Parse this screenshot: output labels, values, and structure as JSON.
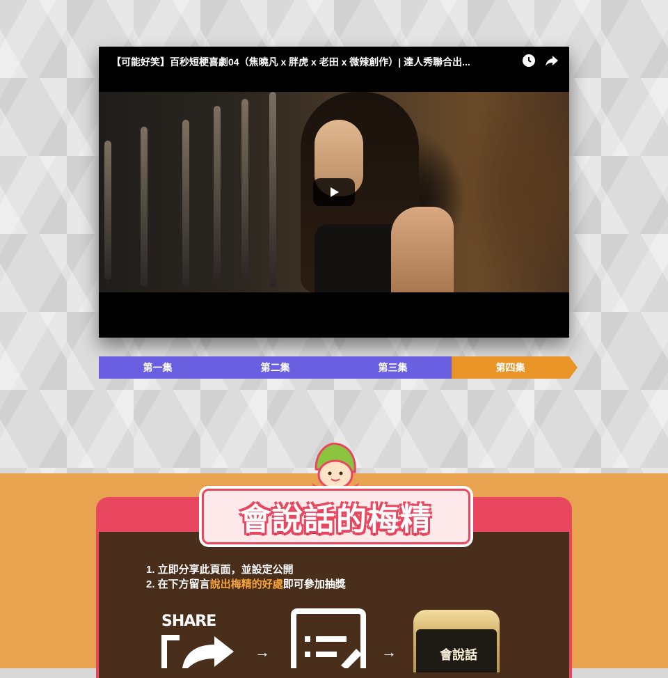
{
  "video": {
    "title": "【可能好笑】百秒短梗喜劇04（焦曉凡 x 胖虎 x 老田 x 微辣創作）| 達人秀聯合出...",
    "watch_later_icon": "clock-icon",
    "share_icon": "share-arrow-icon",
    "play_icon": "play-icon"
  },
  "episodes": [
    {
      "label": "第一集",
      "active": false
    },
    {
      "label": "第二集",
      "active": false
    },
    {
      "label": "第三集",
      "active": false
    },
    {
      "label": "第四集",
      "active": true
    }
  ],
  "promo": {
    "banner_title": "會說話的梅精",
    "rule_1_prefix": "1. 立即分享此頁面，並設定公開",
    "rule_2_prefix": "2. 在下方留言",
    "rule_2_highlight": "說出梅精的好處",
    "rule_2_suffix": "即可參加抽獎",
    "share_label": "SHARE",
    "jar_label": "會說話"
  },
  "colors": {
    "episode_tab": "#6a5fe0",
    "episode_active": "#e89426",
    "orange_bg": "#e9a24f",
    "card_red": "#e9475f",
    "card_brown": "#4a2e1c",
    "highlight": "#f5a23b"
  }
}
